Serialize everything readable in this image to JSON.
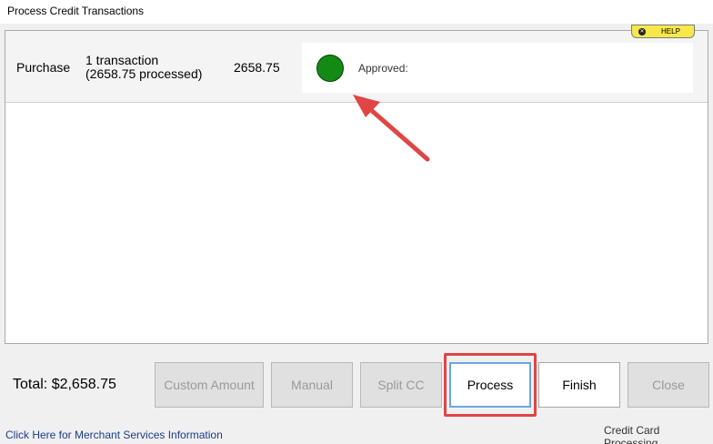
{
  "window": {
    "title": "Process Credit Transactions"
  },
  "transaction": {
    "type": "Purchase",
    "count_line1": "1 transaction",
    "count_line2": "(2658.75 processed)",
    "amount": "2658.75",
    "status_label": "Approved:",
    "status_color": "#138a13"
  },
  "help": {
    "label": "HELP",
    "icon": "close-icon"
  },
  "annotation": {
    "arrow_color": "#e04545",
    "highlight_color": "#e04545"
  },
  "footer": {
    "total": "Total: $2,658.75",
    "merchant_link": "Click Here for Merchant Services Information",
    "section_label": "Credit Card Processing"
  },
  "buttons": {
    "custom_amount": "Custom Amount",
    "manual": "Manual",
    "split_cc": "Split CC",
    "process": "Process",
    "finish": "Finish",
    "close": "Close"
  }
}
